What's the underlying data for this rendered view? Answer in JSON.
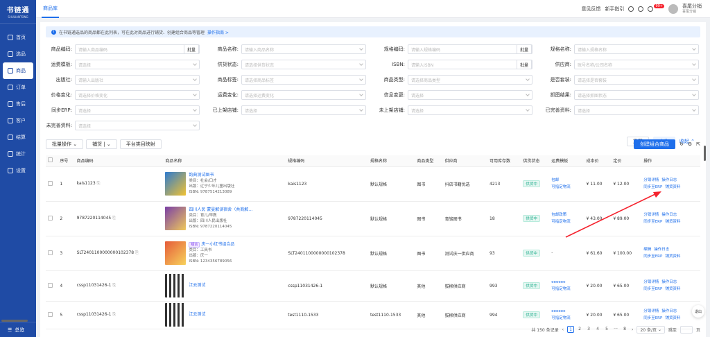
{
  "app": {
    "logo": "书链通",
    "logo_sub": "SHULIANTONG"
  },
  "sidebar": {
    "items": [
      {
        "label": "首页"
      },
      {
        "label": "选品"
      },
      {
        "label": "商品"
      },
      {
        "label": "订单"
      },
      {
        "label": "售后"
      },
      {
        "label": "客户"
      },
      {
        "label": "结算"
      },
      {
        "label": "统计"
      },
      {
        "label": "设置"
      }
    ],
    "bottom": "总览"
  },
  "topbar": {
    "tab": "商品库",
    "feedback": "意见反馈",
    "guide": "新手指引",
    "badge": "99+",
    "user": "喜尾分销",
    "user_sub": "喜尾分销"
  },
  "notice": {
    "text": "在书链通选品的商品都在此列表，可在此对商品进行铺货、创建组合商品等管理",
    "link": "操作指南 >"
  },
  "filters": {
    "r1": [
      {
        "label": "商品编码:",
        "ph": "请输入商品编码",
        "btn": "批量"
      },
      {
        "label": "商品名称:",
        "ph": "请输入商品名称"
      },
      {
        "label": "规格编码:",
        "ph": "请输入规格编码",
        "btn": "批量"
      },
      {
        "label": "规格名称:",
        "ph": "请输入规格名称"
      }
    ],
    "r2": [
      {
        "label": "运费模板:",
        "ph": "请选择"
      },
      {
        "label": "供货状态:",
        "ph": "请选择供货状态"
      },
      {
        "label": "ISBN:",
        "ph": "请输入ISBN",
        "btn": "批量"
      },
      {
        "label": "供应商:",
        "ph": "账号名称/公司名称"
      }
    ],
    "r3": [
      {
        "label": "出版社:",
        "ph": "请输入出版社"
      },
      {
        "label": "商品标签:",
        "ph": "请选择商品标签"
      },
      {
        "label": "商品类型:",
        "ph": "请选择商品类型"
      },
      {
        "label": "是否套装:",
        "ph": "请选择是否套装"
      }
    ],
    "r4": [
      {
        "label": "价格变化:",
        "ph": "请选择价格变化"
      },
      {
        "label": "运费变化:",
        "ph": "请选择运费变化"
      },
      {
        "label": "信息变更:",
        "ph": "请选择"
      },
      {
        "label": "抓图结果:",
        "ph": "请选择抓图状态"
      }
    ],
    "r5": [
      {
        "label": "同步ERP:",
        "ph": "请选择"
      },
      {
        "label": "已上架店铺:",
        "ph": "请选择"
      },
      {
        "label": "未上架店铺:",
        "ph": "请选择"
      },
      {
        "label": "已完善资料:",
        "ph": "请选择"
      }
    ],
    "r6": [
      {
        "label": "未完善资料:",
        "ph": "请选择"
      }
    ],
    "reset": "重置",
    "search": "查询",
    "collapse": "收起"
  },
  "toolbar": {
    "batch": "批量操作",
    "distribute": "铺货",
    "mapping": "平台类目映射",
    "create": "创建组合商品"
  },
  "columns": [
    "序号",
    "商品编码",
    "商品名称",
    "规格编码",
    "规格名称",
    "商品类型",
    "供应商",
    "可用库存数",
    "供货状态",
    "运费模板",
    "成本价",
    "定价",
    "操作"
  ],
  "rows": [
    {
      "no": "1",
      "code": "kais1123",
      "name": "韵典测试图书",
      "l1": "类目：社会/口才",
      "l2": "出版：辽宁少年儿童出版社",
      "l3": "ISBN: 9787514213089",
      "spec_code": "kais1123",
      "spec": "默认规格",
      "type": "图书",
      "supplier": "抖店书籍优选",
      "stock": "4213",
      "status": "供货中",
      "ship1": "包邮",
      "ship2": "可指定物流",
      "cost": "¥ 11.00",
      "price": "¥ 12.00",
      "a1": "分销详情",
      "a2": "操作日志",
      "a3": "同步至ERP",
      "a4": "铺货资料"
    },
    {
      "no": "2",
      "code": "9787220114045",
      "name": "四川人民 蒙曼解读宿舍（共商解…",
      "l1": "类目：育儿/早教",
      "l2": "出版：四川人民出版社",
      "l3": "ISBN: 9787220114045",
      "spec_code": "9787220114045",
      "spec": "默认规格",
      "type": "图书",
      "supplier": "育铭图书",
      "stock": "18",
      "status": "供货中",
      "ship1": "包邮政策",
      "ship2": "可指定物流",
      "cost": "¥ 43.00",
      "price": "¥ 89.00",
      "a1": "分销详情",
      "a2": "操作日志",
      "a3": "同步至ERP",
      "a4": "铺货资料"
    },
    {
      "no": "3",
      "code": "SLT2401100000000102378",
      "tag": "组合",
      "name": "庆一小红书组合品",
      "l1": "类目：工具书",
      "l2": "出版：庆一",
      "l3": "ISBN: 1234356789056",
      "spec_code": "SLT2401100000000102378",
      "spec": "默认规格",
      "type": "图书",
      "supplier": "测试庆一供应商",
      "stock": "93",
      "status": "供货中",
      "ship1": "-",
      "ship2": "",
      "cost": "¥ 61.60",
      "price": "¥ 100.00",
      "a1": "编辑",
      "a2": "操作日志",
      "a3": "同步至ERP",
      "a4": "铺货资料"
    },
    {
      "no": "4",
      "code": "cssp11031426-1",
      "name": "江云测试",
      "l1": "",
      "l2": "",
      "l3": "",
      "spec_code": "cssp11031426-1",
      "spec": "默认规格",
      "type": "其他",
      "supplier": "拔柳供应商",
      "stock": "993",
      "status": "供货中",
      "ship1": "eeeeee",
      "ship2": "可指定物流",
      "cost": "¥ 20.00",
      "price": "¥ 65.00",
      "a1": "分销详情",
      "a2": "操作日志",
      "a3": "同步至ERP",
      "a4": "铺货资料"
    },
    {
      "no": "5",
      "code": "cssp11031426-1",
      "name": "江云测试",
      "l1": "",
      "l2": "",
      "l3": "",
      "spec_code": "test1110-1533",
      "spec": "test1110-1533",
      "type": "其他",
      "supplier": "拔柳供应商",
      "stock": "994",
      "status": "供货中",
      "ship1": "eeeeee",
      "ship2": "可指定物流",
      "cost": "¥ 20.00",
      "price": "¥ 65.00",
      "a1": "分销详情",
      "a2": "操作日志",
      "a3": "同步至ERP",
      "a4": "铺货资料"
    }
  ],
  "pager": {
    "total": "共 150 条记录",
    "pages": [
      "1",
      "2",
      "3",
      "4",
      "5",
      "···",
      "8"
    ],
    "size": "20 条/页",
    "goto": "跳至",
    "page_unit": "页"
  },
  "float": {
    "label": "退出"
  }
}
